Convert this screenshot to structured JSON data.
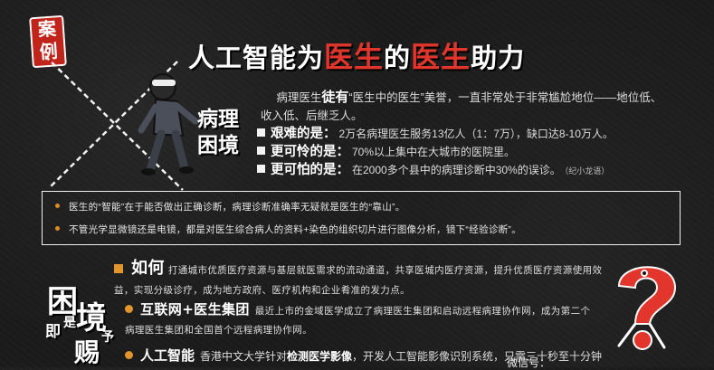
{
  "tag": {
    "line1": "案",
    "line2": "例"
  },
  "title": {
    "p1": "人工智能为",
    "p2": "医生",
    "p3": "的",
    "p4": "医生",
    "p5": "助力"
  },
  "section1": {
    "line1": "病理",
    "line2": "困境"
  },
  "intro": {
    "pre": "病理医生",
    "bold": "徒有",
    "post": "“医生中的医生”美誉，一直非常处于非常尴尬地位——地位低、收入低、后继乏人。"
  },
  "bullets": [
    {
      "key": "艰难的是：",
      "text": "2万名病理医生服务13亿人（1：7万），缺口达8-10万人。",
      "note": ""
    },
    {
      "key": "更可怜的是：",
      "text": "70%以上集中在大城市的医院里。",
      "note": ""
    },
    {
      "key": "更可怕的是：",
      "text": "在2000多个县中的病理诊断中30%的误诊。",
      "note": "（纪小龙语）"
    }
  ],
  "box": {
    "item1": "医生的“智能”在于能否做出正确诊断，病理诊断准确率无疑就是医生的“靠山”。",
    "item2": "不管光学显微镜还是电镜，都是对医生综合病人的资料+染色的组织切片进行图像分析，镜下“经验诊断”。"
  },
  "section2": {
    "c1": "困",
    "c2": "即",
    "c3": "是",
    "c4": "境",
    "c5": "赐",
    "c6": "予"
  },
  "how": {
    "head": "如何",
    "text": "打通城市优质医疗资源与基层就医需求的流动通道，共享医城内医疗资源，提升优质医疗资源使用效益，实现分级诊疗，成为地方政府、医疗机构和企业肴准的发力点。"
  },
  "internet": {
    "head": "互联网+医生集团",
    "text": "最近上市的金域医学成立了病理医生集团和启动远程病理协作网，成为第二个病理医生集团和全国首个远程病理协作网。"
  },
  "ai": {
    "head": "人工智能",
    "pre": "香港中文大学针对",
    "bold": "检测医学影像",
    "post": "，开发人工智能影像识别系统，只需三十秒至十分钟"
  },
  "watermark": "微信号：",
  "colors": {
    "accent_red": "#e2352b",
    "accent_orange": "#e2952c",
    "background": "#1b1b1b"
  }
}
